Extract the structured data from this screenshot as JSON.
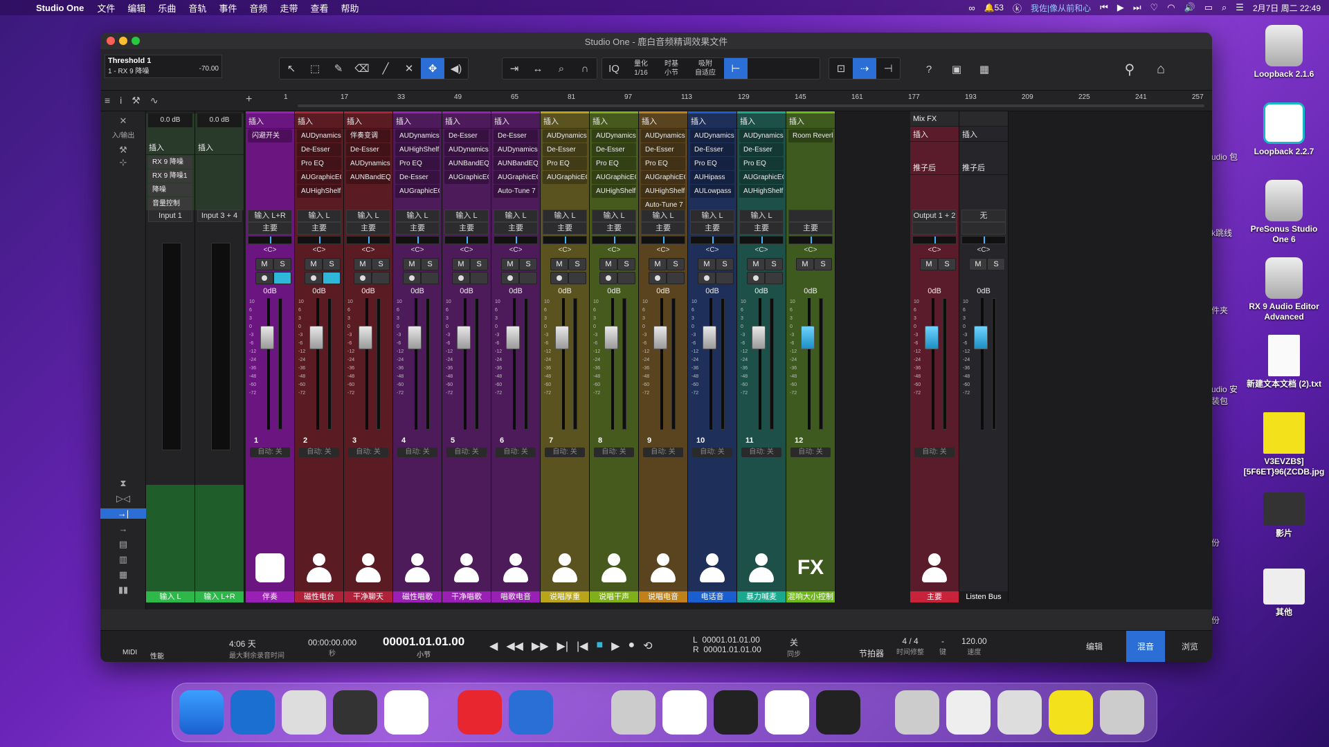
{
  "menubar": {
    "app": "Studio One",
    "items": [
      "文件",
      "编辑",
      "乐曲",
      "音轨",
      "事件",
      "音频",
      "走带",
      "查看",
      "帮助"
    ],
    "notif": "53",
    "user": "我佐|像从前和心",
    "clock": "2月7日 周二 22:49"
  },
  "desktop": [
    {
      "label": "Loopback 2.1.6"
    },
    {
      "label": "Loopback 2.2.7"
    },
    {
      "label": "PreSonus Studio One 6"
    },
    {
      "label": "RX 9 Audio Editor Advanced"
    },
    {
      "label": "新建文本文档 (2).txt"
    },
    {
      "label": "V3EVZB$][5F6ET}96(ZCDB.jpg"
    },
    {
      "label": "影片"
    },
    {
      "label": "其他"
    }
  ],
  "desktop_side": [
    "udio 包",
    "k跳线",
    "件夹",
    "udio 安装包",
    "份",
    "份"
  ],
  "window": {
    "title": "Studio One - 鹿白音频精调效果文件"
  },
  "track": {
    "name": "Threshold 1",
    "sub": "1 - RX 9 降噪",
    "value": "-70.00"
  },
  "toolbar": {
    "quantize_label": "量化",
    "quantize": "1/16",
    "timebase_label": "时基",
    "timebase": "小节",
    "snap_label": "吸附",
    "snap": "自适应",
    "iq": "IQ",
    "help": "?"
  },
  "ruler": {
    "marks": [
      "1",
      "17",
      "33",
      "49",
      "65",
      "81",
      "97",
      "113",
      "129",
      "145",
      "161",
      "177",
      "193",
      "209",
      "225",
      "241",
      "257"
    ]
  },
  "left_panel": {
    "input_label": "入/输出"
  },
  "inputs": [
    {
      "gain": "0.0 dB",
      "ins": "插入",
      "plugins": [
        "RX 9 降噪",
        "RX 9 降噪1",
        "降噪",
        "音量控制"
      ],
      "io": "Input 1",
      "name": "输入 L"
    },
    {
      "gain": "0.0 dB",
      "ins": "插入",
      "plugins": [],
      "io": "Input 3 + 4",
      "name": "输入 L+R"
    }
  ],
  "channels": [
    {
      "num": "1",
      "name": "伴奏",
      "ins": "插入",
      "plugins": [
        "闪避开关"
      ],
      "io": "输入 L+R",
      "bus": "主要",
      "db": "0dB",
      "auto": "自动: 关",
      "color": "#9a1fb4",
      "dark": "#6b1680",
      "icon": "mixer"
    },
    {
      "num": "2",
      "name": "磁性电台",
      "ins": "插入",
      "plugins": [
        "AUDynamics",
        "De-Esser",
        "Pro EQ",
        "AUGraphicEQ",
        "AUHighShelf"
      ],
      "io": "输入 L",
      "bus": "主要",
      "db": "0dB",
      "auto": "自动: 关",
      "color": "#b0213a",
      "dark": "#5a1b22",
      "icon": "singer"
    },
    {
      "num": "3",
      "name": "干净聊天",
      "ins": "插入",
      "plugins": [
        "伴奏变调",
        "De-Esser",
        "AUDynamics",
        "AUNBandEQ"
      ],
      "io": "输入 L",
      "bus": "主要",
      "db": "0dB",
      "auto": "自动: 关",
      "color": "#b0213a",
      "dark": "#5a1b22",
      "icon": "singer"
    },
    {
      "num": "4",
      "name": "磁性唱歌",
      "ins": "插入",
      "plugins": [
        "AUDynamics",
        "AUHighShelf",
        "Pro EQ",
        "De-Esser",
        "AUGraphicEQ"
      ],
      "io": "输入 L",
      "bus": "主要",
      "db": "0dB",
      "auto": "自动: 关",
      "color": "#9a1fb4",
      "dark": "#4d1a5a",
      "icon": "singer"
    },
    {
      "num": "5",
      "name": "干净唱歌",
      "ins": "插入",
      "plugins": [
        "De-Esser",
        "AUDynamics",
        "AUNBandEQ",
        "AUGraphicEQ"
      ],
      "io": "输入 L",
      "bus": "主要",
      "db": "0dB",
      "auto": "自动: 关",
      "color": "#9a1fb4",
      "dark": "#4d1a5a",
      "icon": "singer"
    },
    {
      "num": "6",
      "name": "唱歌电音",
      "ins": "插入",
      "plugins": [
        "De-Esser",
        "AUDynamics",
        "AUNBandEQ",
        "AUGraphicEQ",
        "Auto-Tune 7"
      ],
      "io": "输入 L",
      "bus": "主要",
      "db": "0dB",
      "auto": "自动: 关",
      "color": "#9a1fb4",
      "dark": "#4d1a5a",
      "icon": "singer"
    },
    {
      "num": "7",
      "name": "说唱厚重",
      "ins": "插入",
      "plugins": [
        "AUDynamics",
        "De-Esser",
        "Pro EQ",
        "AUGraphicEQ"
      ],
      "io": "输入 L",
      "bus": "主要",
      "db": "0dB",
      "auto": "自动: 关",
      "color": "#b8a51a",
      "dark": "#5a5320",
      "icon": "singer"
    },
    {
      "num": "8",
      "name": "说唱干声",
      "ins": "插入",
      "plugins": [
        "AUDynamics",
        "De-Esser",
        "Pro EQ",
        "AUGraphicEQ",
        "AUHighShelf"
      ],
      "io": "输入 L",
      "bus": "主要",
      "db": "0dB",
      "auto": "自动: 关",
      "color": "#7fb01a",
      "dark": "#465a1e",
      "icon": "singer"
    },
    {
      "num": "9",
      "name": "说唱电音",
      "ins": "插入",
      "plugins": [
        "AUDynamics",
        "De-Esser",
        "Pro EQ",
        "AUGraphicEQ",
        "AUHighShelf",
        "Auto-Tune 7"
      ],
      "io": "输入 L",
      "bus": "主要",
      "db": "0dB",
      "auto": "自动: 关",
      "color": "#c0801a",
      "dark": "#5a4420",
      "icon": "singer"
    },
    {
      "num": "10",
      "name": "电话音",
      "ins": "插入",
      "plugins": [
        "AUDynamics",
        "De-Esser",
        "Pro EQ",
        "AUHipass",
        "AULowpass"
      ],
      "io": "输入 L",
      "bus": "主要",
      "db": "0dB",
      "auto": "自动: 关",
      "color": "#1a5fd0",
      "dark": "#1e2f5a",
      "icon": "singer"
    },
    {
      "num": "11",
      "name": "暴力喊麦",
      "ins": "插入",
      "plugins": [
        "AUDynamics",
        "De-Esser",
        "Pro EQ",
        "AUGraphicEQ",
        "AUHighShelf"
      ],
      "io": "输入 L",
      "bus": "主要",
      "db": "0dB",
      "auto": "自动: 关",
      "color": "#1aa88f",
      "dark": "#1d5049",
      "icon": "singer"
    },
    {
      "num": "12",
      "name": "混响大小控制",
      "ins": "插入",
      "plugins": [
        "Room Reverb"
      ],
      "io": "",
      "bus": "主要",
      "db": "0dB",
      "auto": "自动: 关",
      "color": "#6fb81a",
      "dark": "#3e5a1e",
      "icon": "fx",
      "fx": "FX"
    }
  ],
  "outputs": [
    {
      "name": "主要",
      "ins": "插入",
      "pre": "推子后",
      "io": "Output 1 + 2",
      "db": "0dB",
      "auto": "自动: 关",
      "mixfx": "Mix FX"
    },
    {
      "name": "Listen Bus",
      "ins": "插入",
      "pre": "推子后",
      "io": "无",
      "db": "0dB"
    }
  ],
  "strip_labels": {
    "m": "M",
    "s": "S",
    "pan": "<C>",
    "l": "L"
  },
  "transport": {
    "midi": "MIDI",
    "perf": "性能",
    "rec_time": "4:06 天",
    "rec_label": "最大剩余录音时间",
    "time": "00:00:00.000",
    "time_label": "秒",
    "bars": "00001.01.01.00",
    "bars_label": "小节",
    "loopL": "00001.01.01.00",
    "loopR": "00001.01.01.00",
    "L": "L",
    "R": "R",
    "sync": "关",
    "sync_label": "同步",
    "metro_label": "节拍器",
    "sig": "4 / 4",
    "sig_label": "时间修整",
    "key": "-",
    "key_label": "键",
    "tempo": "120.00",
    "tempo_label": "速度",
    "tabs": [
      "编辑",
      "混音",
      "浏览"
    ]
  }
}
